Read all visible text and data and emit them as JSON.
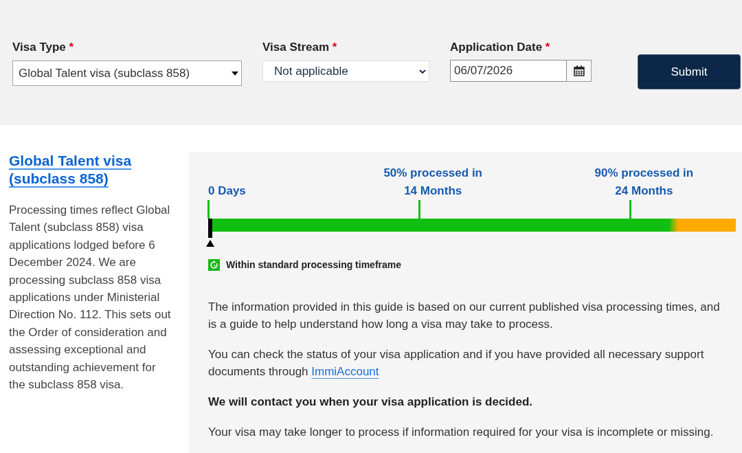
{
  "form": {
    "fields": [
      {
        "kind": "dropdown",
        "label": "Visa Type",
        "required_mark": "*",
        "value": "Global Talent visa (subclass 858)"
      },
      {
        "kind": "select",
        "label": "Visa Stream",
        "required_mark": "*",
        "value": "Not applicable"
      },
      {
        "kind": "date",
        "label": "Application Date",
        "required_mark": "*",
        "value": "06/07/2026"
      }
    ],
    "submit_button": "Submit"
  },
  "visa_summary": {
    "title": "Global Talent visa (subclass 858)",
    "description": "Processing times reflect Global Talent (subclass 858) visa applications lodged before 6 December 2024. We are processing subclass 858 visa applications under Ministerial Direction No. 112. This sets out the Order of consideration and assessing exceptional and outstanding achievement for the subclass 858 visa."
  },
  "timeline": {
    "milestones": [
      {
        "duration": "0 Days",
        "level": 0
      },
      {
        "caption": "50% processed in",
        "duration": "14 Months",
        "level": 0.4
      },
      {
        "caption": "90% processed in",
        "duration": "24 Months",
        "level": 0.8
      }
    ],
    "progress": {
      "level": 0.89
    },
    "current_position": {
      "level": 0
    },
    "legend": "Within standard processing timeframe"
  },
  "info": [
    {
      "kind": "text",
      "text": "The information provided in this guide is based on our current published visa processing times, and is a guide to help understand how long a visa may take to process."
    },
    {
      "kind": "text",
      "text": "You can check the status of your visa application and if you have provided all necessary support documents through",
      "link": "ImmiAccount"
    },
    {
      "kind": "bold",
      "text": "We will contact you when your visa application is decided."
    },
    {
      "kind": "text",
      "text": "Your visa may take longer to process if information required for your visa is incomplete or missing."
    }
  ]
}
